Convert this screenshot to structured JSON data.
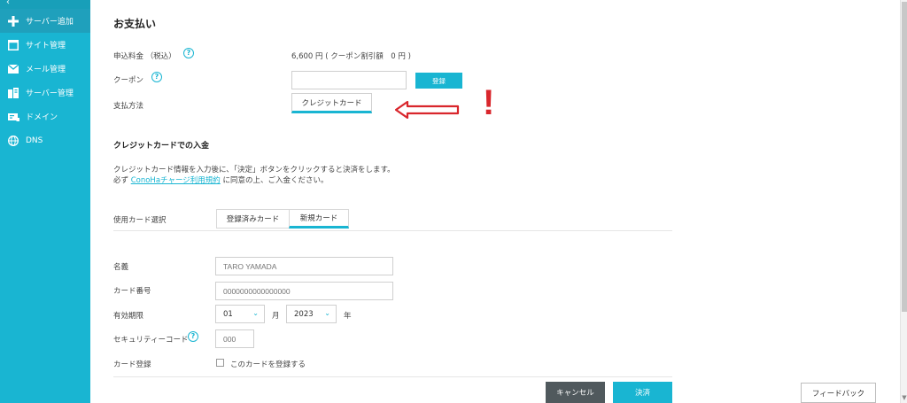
{
  "sidebar": {
    "collapse_glyph": "‹",
    "items": [
      {
        "label": "サーバー追加",
        "icon": "plus-icon"
      },
      {
        "label": "サイト管理",
        "icon": "window-icon"
      },
      {
        "label": "メール管理",
        "icon": "mail-icon"
      },
      {
        "label": "サーバー管理",
        "icon": "server-icon"
      },
      {
        "label": "ドメイン",
        "icon": "domain-icon"
      },
      {
        "label": "DNS",
        "icon": "globe-icon"
      }
    ]
  },
  "page": {
    "title": "お支払い",
    "fee": {
      "label": "申込料金 （税込）",
      "value": "6,600 円 ( クーポン割引額　0 円 )"
    },
    "coupon": {
      "label": "クーポン",
      "value": "",
      "register_button": "登録"
    },
    "payment_method": {
      "label": "支払方法",
      "selected": "クレジットカード"
    },
    "annotation": {
      "arrow": "⇐",
      "mark": "!"
    },
    "credit_section": {
      "heading": "クレジットカードでの入金",
      "description_line1": "クレジットカード情報を入力後に、「決定」ボタンをクリックすると決済をします。",
      "description_prefix": "必ず ",
      "terms_link": "ConoHaチャージ利用規約",
      "description_suffix": " に同意の上、ご入金ください。"
    },
    "card_select": {
      "label": "使用カード選択",
      "tabs": [
        "登録済みカード",
        "新規カード"
      ],
      "active_tab": "新規カード"
    },
    "form": {
      "name": {
        "label": "名義",
        "placeholder": "TARO YAMADA"
      },
      "number": {
        "label": "カード番号",
        "placeholder": "0000000000000000"
      },
      "expiry": {
        "label": "有効期限",
        "month": "01",
        "month_unit": "月",
        "year": "2023",
        "year_unit": "年"
      },
      "security": {
        "label": "セキュリティーコード",
        "placeholder": "000"
      },
      "register": {
        "label": "カード登録",
        "checkbox_label": "このカードを登録する"
      }
    },
    "buttons": {
      "cancel": "キャンセル",
      "confirm": "決済"
    },
    "feedback": "フィードバック"
  },
  "colors": {
    "accent": "#19b5d2",
    "sidebar": "#19b5d2",
    "annotation": "#d9262c",
    "dark_button": "#50595d"
  }
}
